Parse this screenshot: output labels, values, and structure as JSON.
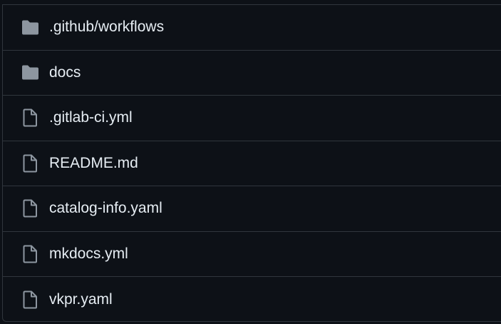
{
  "files": [
    {
      "name": ".github/workflows",
      "type": "folder",
      "icon": "folder-icon"
    },
    {
      "name": "docs",
      "type": "folder",
      "icon": "folder-icon"
    },
    {
      "name": ".gitlab-ci.yml",
      "type": "file",
      "icon": "file-icon"
    },
    {
      "name": "README.md",
      "type": "file",
      "icon": "file-icon"
    },
    {
      "name": "catalog-info.yaml",
      "type": "file",
      "icon": "file-icon"
    },
    {
      "name": "mkdocs.yml",
      "type": "file",
      "icon": "file-icon"
    },
    {
      "name": "vkpr.yaml",
      "type": "file",
      "icon": "file-icon"
    }
  ],
  "colors": {
    "background": "#0d1117",
    "border": "#30363d",
    "text": "#e6edf3",
    "folder_icon": "#8d96a0",
    "file_icon": "#8d96a0"
  }
}
